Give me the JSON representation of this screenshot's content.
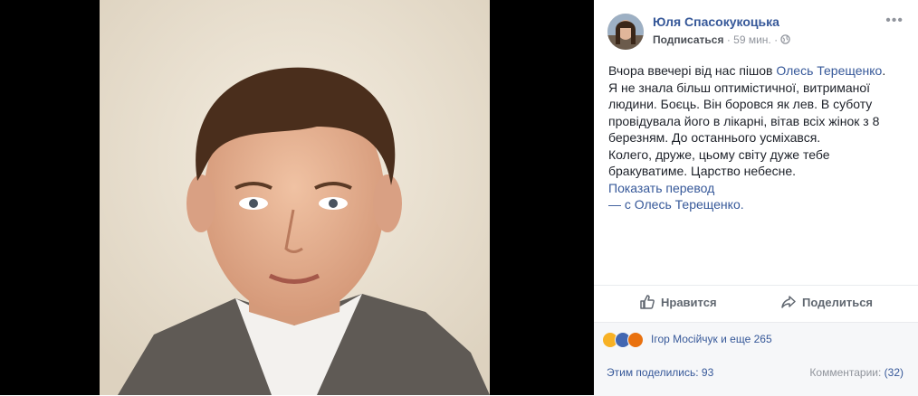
{
  "post": {
    "author": "Юля Спасокукоцька",
    "subscribe_label": "Подписаться",
    "time": "59 мин.",
    "separator": "·",
    "privacy_icon": "globe-icon",
    "more_icon": "more-dots-icon",
    "text_before_tag": "Вчора ввечері від нас пішов ",
    "tagged_name": "Олесь Терещенко",
    "text_after_tag": ". Я не знала більш оптимістичної, витриманої людини. Боєць. Він боровся як лев. В суботу провідувала його в лікарні, вітав всіх жінок з 8 березням. До останнього усміхався.",
    "text_line2": "Колего, друже, цьому світу дуже тебе бракуватиме. Царство небесне.",
    "translate_label": "Показать перевод",
    "with_prefix": "— с ",
    "with_name": "Олесь Терещенко",
    "with_suffix": "."
  },
  "actions": {
    "like_label": "Нравится",
    "share_label": "Поделиться"
  },
  "reactions": {
    "icons": [
      "sad-icon",
      "like-icon",
      "angry-icon"
    ],
    "colors": {
      "sad": "#f7b125",
      "like": "#4267b2",
      "angry": "#e9710f"
    },
    "names": "Ігор Мосійчук и еще 265",
    "shares_label": "Этим поделились: 93",
    "comments_prefix": "Комментарии: ",
    "comments_count": "(32)"
  }
}
